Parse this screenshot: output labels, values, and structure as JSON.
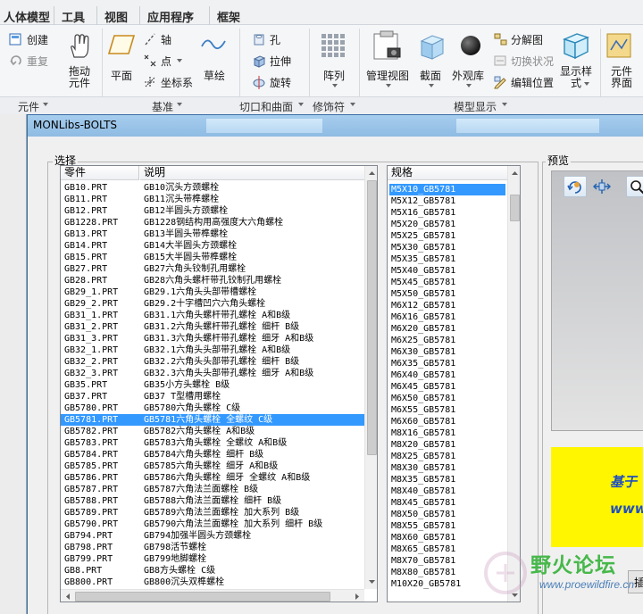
{
  "ribbon": {
    "tabs": [
      "人体模型",
      "工具",
      "视图",
      "应用程序",
      "框架"
    ],
    "buttons": {
      "create": "创建",
      "redo": "重复",
      "drag_line1": "拖动",
      "drag_line2": "元件",
      "plane": "平面",
      "axis": "轴",
      "point": "点",
      "coord": "坐标系",
      "sketch": "草绘",
      "hole": "孔",
      "extrude": "拉伸",
      "revolve": "旋转",
      "pattern": "阵列",
      "manage_view": "管理视图",
      "section": "截面",
      "appearance": "外观库",
      "explode": "分解图",
      "toggle_state": "切换状况",
      "edit_position": "编辑位置",
      "display_style_line1": "显示样",
      "display_style_line2": "式",
      "component_ui_line1": "元件",
      "component_ui_line2": "界面"
    },
    "groups": [
      "元件",
      "基准",
      "切口和曲面",
      "修饰符",
      "模型显示"
    ]
  },
  "dialog": {
    "title": "MONLibs-BOLTS",
    "select_legend": "选择",
    "preview_legend": "预览",
    "col_part": "零件",
    "col_desc": "说明",
    "col_spec": "规格",
    "parts": [
      {
        "part": "GB10.PRT",
        "desc": "GB10沉头方颈螺栓"
      },
      {
        "part": "GB11.PRT",
        "desc": "GB11沉头带榫螺栓"
      },
      {
        "part": "GB12.PRT",
        "desc": "GB12半圆头方颈螺栓"
      },
      {
        "part": "GB1228.PRT",
        "desc": "GB1228钢结构用高强度大六角螺栓"
      },
      {
        "part": "GB13.PRT",
        "desc": "GB13半圆头带榫螺栓"
      },
      {
        "part": "GB14.PRT",
        "desc": "GB14大半圆头方颈螺栓"
      },
      {
        "part": "GB15.PRT",
        "desc": "GB15大半圆头带榫螺栓"
      },
      {
        "part": "GB27.PRT",
        "desc": "GB27六角头铰制孔用螺栓"
      },
      {
        "part": "GB28.PRT",
        "desc": "GB28六角头螺杆带孔铰制孔用螺栓"
      },
      {
        "part": "GB29_1.PRT",
        "desc": "GB29.1六角头头部带槽螺栓"
      },
      {
        "part": "GB29_2.PRT",
        "desc": "GB29.2十字槽凹穴六角头螺栓"
      },
      {
        "part": "GB31_1.PRT",
        "desc": "GB31.1六角头螺杆带孔螺栓  A和B级"
      },
      {
        "part": "GB31_2.PRT",
        "desc": "GB31.2六角头螺杆带孔螺栓  细杆  B级"
      },
      {
        "part": "GB31_3.PRT",
        "desc": "GB31.3六角头螺杆带孔螺栓  细牙  A和B级"
      },
      {
        "part": "GB32_1.PRT",
        "desc": "GB32.1六角头头部带孔螺栓  A和B级"
      },
      {
        "part": "GB32_2.PRT",
        "desc": "GB32.2六角头头部带孔螺栓  细杆  B级"
      },
      {
        "part": "GB32_3.PRT",
        "desc": "GB32.3六角头头部带孔螺栓  细牙  A和B级"
      },
      {
        "part": "GB35.PRT",
        "desc": "GB35小方头螺栓  B级"
      },
      {
        "part": "GB37.PRT",
        "desc": "GB37 T型槽用螺栓"
      },
      {
        "part": "GB5780.PRT",
        "desc": "GB5780六角头螺栓  C级"
      },
      {
        "part": "GB5781.PRT",
        "desc": "GB5781六角头螺栓  全螺纹  C级"
      },
      {
        "part": "GB5782.PRT",
        "desc": "GB5782六角头螺栓  A和B级"
      },
      {
        "part": "GB5783.PRT",
        "desc": "GB5783六角头螺栓  全螺纹  A和B级"
      },
      {
        "part": "GB5784.PRT",
        "desc": "GB5784六角头螺栓  细杆  B级"
      },
      {
        "part": "GB5785.PRT",
        "desc": "GB5785六角头螺栓  细牙  A和B级"
      },
      {
        "part": "GB5786.PRT",
        "desc": "GB5786六角头螺栓  细牙  全螺纹  A和B级"
      },
      {
        "part": "GB5787.PRT",
        "desc": "GB5787六角法兰面螺栓  B级"
      },
      {
        "part": "GB5788.PRT",
        "desc": "GB5788六角法兰面螺栓  细杆  B级"
      },
      {
        "part": "GB5789.PRT",
        "desc": "GB5789六角法兰面螺栓  加大系列  B级"
      },
      {
        "part": "GB5790.PRT",
        "desc": "GB5790六角法兰面螺栓  加大系列  细杆  B级"
      },
      {
        "part": "GB794.PRT",
        "desc": "GB794加强半圆头方颈螺栓"
      },
      {
        "part": "GB798.PRT",
        "desc": "GB798活节螺栓"
      },
      {
        "part": "GB799.PRT",
        "desc": "GB799地脚螺栓"
      },
      {
        "part": "GB8.PRT",
        "desc": "GB8方头螺栓  C级"
      },
      {
        "part": "GB800.PRT",
        "desc": "GB800沉头双榫螺栓"
      }
    ],
    "selected_part_index": 20,
    "specs": [
      "M5X10_GB5781",
      "M5X12_GB5781",
      "M5X16_GB5781",
      "M5X20_GB5781",
      "M5X25_GB5781",
      "M5X30_GB5781",
      "M5X35_GB5781",
      "M5X40_GB5781",
      "M5X45_GB5781",
      "M5X50_GB5781",
      "M6X12_GB5781",
      "M6X16_GB5781",
      "M6X20_GB5781",
      "M6X25_GB5781",
      "M6X30_GB5781",
      "M6X35_GB5781",
      "M6X40_GB5781",
      "M6X45_GB5781",
      "M6X50_GB5781",
      "M6X55_GB5781",
      "M6X60_GB5781",
      "M8X16_GB5781",
      "M8X20_GB5781",
      "M8X25_GB5781",
      "M8X30_GB5781",
      "M8X35_GB5781",
      "M8X40_GB5781",
      "M8X45_GB5781",
      "M8X50_GB5781",
      "M8X55_GB5781",
      "M8X60_GB5781",
      "M8X65_GB5781",
      "M8X70_GB5781",
      "M8X80_GB5781",
      "M10X20_GB5781"
    ],
    "selected_spec_index": 0,
    "banner_line1": "基于",
    "banner_line2": "www",
    "insert_button": "插"
  },
  "watermark": {
    "title": "野火论坛",
    "url": "www.proewildfire.cn"
  },
  "colors": {
    "selection": "#3399ff",
    "banner": "#fff600",
    "titlebar": "#9cc5ea"
  }
}
